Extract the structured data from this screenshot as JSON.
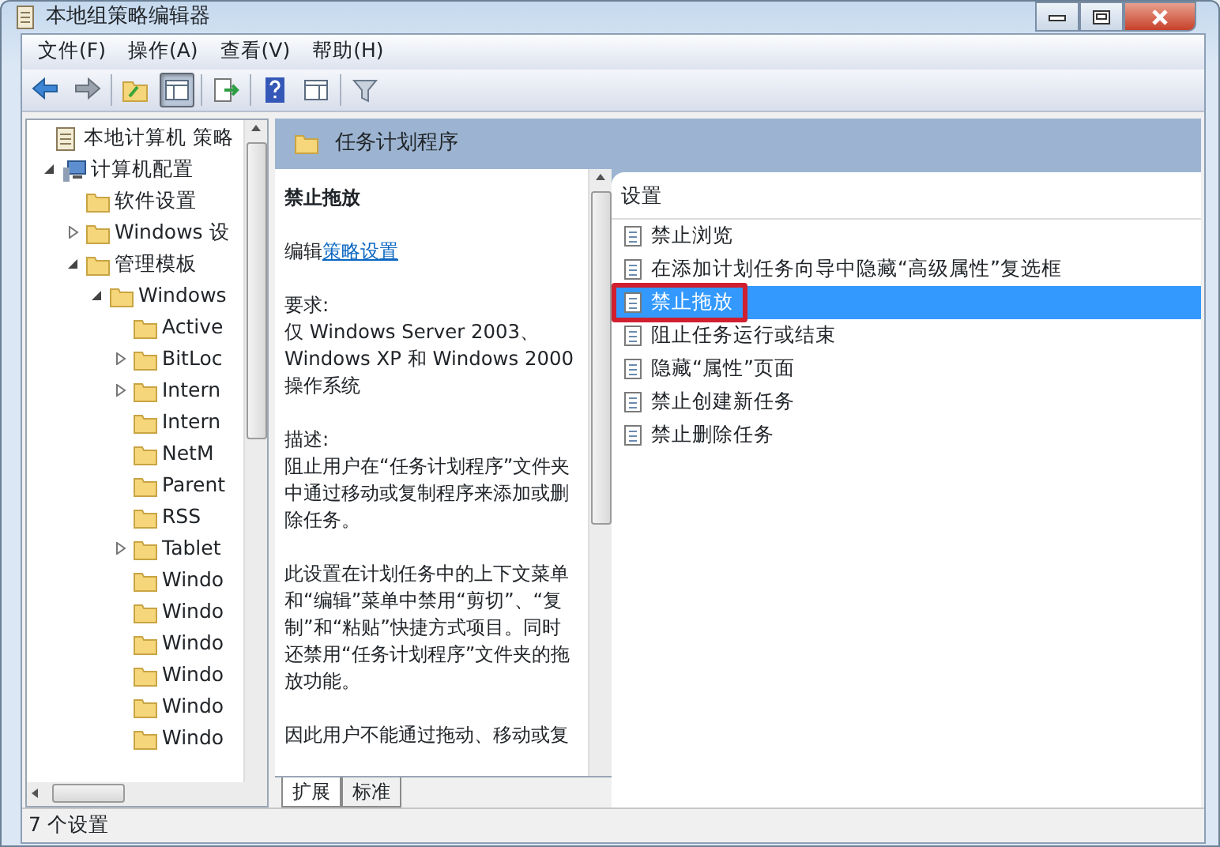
{
  "window": {
    "title": "本地组策略编辑器"
  },
  "menu": [
    "文件(F)",
    "操作(A)",
    "查看(V)",
    "帮助(H)"
  ],
  "toolbar": [
    {
      "kind": "back",
      "pressed": false
    },
    {
      "kind": "forward",
      "pressed": false
    },
    {
      "kind": "sep"
    },
    {
      "kind": "up",
      "pressed": false
    },
    {
      "kind": "tree",
      "pressed": true
    },
    {
      "kind": "sep"
    },
    {
      "kind": "export",
      "pressed": false
    },
    {
      "kind": "sep"
    },
    {
      "kind": "help",
      "pressed": false
    },
    {
      "kind": "pane",
      "pressed": false
    },
    {
      "kind": "sep"
    },
    {
      "kind": "filter",
      "pressed": false
    }
  ],
  "tree": [
    {
      "label": "本地计算机 策略",
      "kind": "policy",
      "children": [
        {
          "label": "计算机配置",
          "kind": "computer",
          "expanded": true,
          "children": [
            {
              "label": "软件设置",
              "kind": "folder"
            },
            {
              "label": "Windows 设",
              "kind": "folder",
              "expanded": false
            },
            {
              "label": "管理模板",
              "kind": "folder",
              "expanded": true,
              "children": [
                {
                  "label": "Windows",
                  "kind": "folder",
                  "expanded": true,
                  "children": [
                    {
                      "label": "Active",
                      "kind": "folder"
                    },
                    {
                      "label": "BitLoc",
                      "kind": "folder",
                      "expanded": false
                    },
                    {
                      "label": "Intern",
                      "kind": "folder",
                      "expanded": false
                    },
                    {
                      "label": "Intern",
                      "kind": "folder"
                    },
                    {
                      "label": "NetM",
                      "kind": "folder"
                    },
                    {
                      "label": "Parent",
                      "kind": "folder"
                    },
                    {
                      "label": "RSS",
                      "kind": "folder"
                    },
                    {
                      "label": "Tablet",
                      "kind": "folder",
                      "expanded": false
                    },
                    {
                      "label": "Windo",
                      "kind": "folder"
                    },
                    {
                      "label": "Windo",
                      "kind": "folder"
                    },
                    {
                      "label": "Windo",
                      "kind": "folder"
                    },
                    {
                      "label": "Windo",
                      "kind": "folder"
                    },
                    {
                      "label": "Windo",
                      "kind": "folder"
                    },
                    {
                      "label": "Windo",
                      "kind": "folder"
                    }
                  ]
                }
              ]
            }
          ]
        }
      ]
    }
  ],
  "header": {
    "title": "任务计划程序"
  },
  "description": {
    "title": "禁止拖放",
    "edit_prefix": "编辑",
    "edit_link": "策略设置",
    "paragraphs": [
      "要求:\n仅 Windows Server 2003、Windows XP 和 Windows 2000 操作系统",
      "描述:\n阻止用户在“任务计划程序”文件夹中通过移动或复制程序来添加或删除任务。",
      "此设置在计划任务中的上下文菜单和“编辑”菜单中禁用“剪切”、“复制”和“粘贴”快捷方式项目。同时还禁用“任务计划程序”文件夹的拖放功能。",
      "因此用户不能通过拖动、移动或复"
    ]
  },
  "view_tabs": [
    {
      "label": "扩展",
      "selected": true
    },
    {
      "label": "标准",
      "selected": false
    }
  ],
  "settings": {
    "column": "设置",
    "items": [
      {
        "label": "禁止浏览",
        "selected": false
      },
      {
        "label": "在添加计划任务向导中隐藏“高级属性”复选框",
        "selected": false
      },
      {
        "label": "禁止拖放",
        "selected": true
      },
      {
        "label": "阻止任务运行或结束",
        "selected": false
      },
      {
        "label": "隐藏“属性”页面",
        "selected": false
      },
      {
        "label": "禁止创建新任务",
        "selected": false
      },
      {
        "label": "禁止删除任务",
        "selected": false
      }
    ]
  },
  "status_bar": "7 个设置"
}
